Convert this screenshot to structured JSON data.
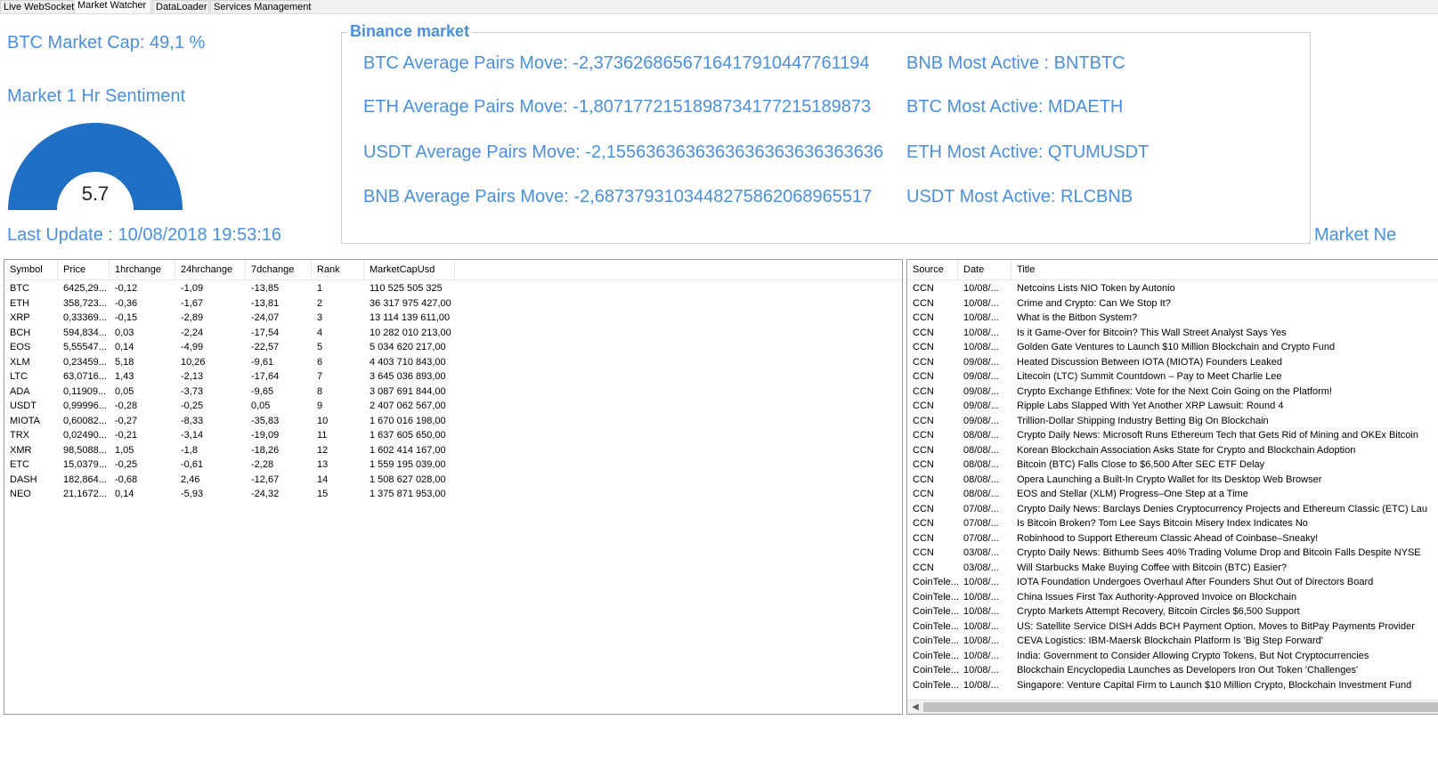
{
  "tabs": [
    {
      "label": "Live WebSocket",
      "active": false
    },
    {
      "label": "Market Watcher",
      "active": true
    },
    {
      "label": "DataLoader",
      "active": false
    },
    {
      "label": "Services Management",
      "active": false
    }
  ],
  "summary": {
    "market_cap_label": "BTC Market Cap: 49,1 %",
    "sentiment_label": "Market 1 Hr Sentiment",
    "gauge_value": "5.7",
    "last_update": "Last Update : 10/08/2018 19:53:16",
    "market_news_label": "Market Ne"
  },
  "colors": {
    "accent": "#4a8fe0",
    "gauge_fill": "#1f6fc5"
  },
  "binance": {
    "title": "Binance market",
    "rows": [
      {
        "move": "BTC Average Pairs Move: -2,3736268656716417910447761194",
        "active": "BNB Most Active : BNTBTC"
      },
      {
        "move": "ETH Average Pairs Move: -1,8071772151898734177215189873",
        "active": "BTC Most Active: MDAETH"
      },
      {
        "move": "USDT Average Pairs Move: -2,1556363636363636363636363636",
        "active": "ETH Most Active: QTUMUSDT"
      },
      {
        "move": "BNB Average Pairs Move: -2,6873793103448275862068965517",
        "active": "USDT Most Active: RLCBNB"
      }
    ]
  },
  "coins": {
    "columns": [
      "Symbol",
      "Price",
      "1hrchange",
      "24hrchange",
      "7dchange",
      "Rank",
      "MarketCapUsd"
    ],
    "rows": [
      [
        "BTC",
        "6425,29...",
        "-0,12",
        "-1,09",
        "-13,85",
        "1",
        "110 525 505 325"
      ],
      [
        "ETH",
        "358,723...",
        "-0,36",
        "-1,67",
        "-13,81",
        "2",
        "36 317 975 427,00"
      ],
      [
        "XRP",
        "0,33369...",
        "-0,15",
        "-2,89",
        "-24,07",
        "3",
        "13 114 139 611,00"
      ],
      [
        "BCH",
        "594,834...",
        "0,03",
        "-2,24",
        "-17,54",
        "4",
        "10 282 010 213,00"
      ],
      [
        "EOS",
        "5,55547...",
        "0,14",
        "-4,99",
        "-22,57",
        "5",
        "5 034 620 217,00"
      ],
      [
        "XLM",
        "0,23459...",
        "5,18",
        "10,26",
        "-9,61",
        "6",
        "4 403 710 843,00"
      ],
      [
        "LTC",
        "63,0716...",
        "1,43",
        "-2,13",
        "-17,64",
        "7",
        "3 645 036 893,00"
      ],
      [
        "ADA",
        "0,11909...",
        "0,05",
        "-3,73",
        "-9,65",
        "8",
        "3 087 691 844,00"
      ],
      [
        "USDT",
        "0,99996...",
        "-0,28",
        "-0,25",
        "0,05",
        "9",
        "2 407 062 567,00"
      ],
      [
        "MIOTA",
        "0,60082...",
        "-0,27",
        "-8,33",
        "-35,83",
        "10",
        "1 670 016 198,00"
      ],
      [
        "TRX",
        "0,02490...",
        "-0,21",
        "-3,14",
        "-19,09",
        "11",
        "1 637 605 650,00"
      ],
      [
        "XMR",
        "98,5088...",
        "1,05",
        "-1,8",
        "-18,26",
        "12",
        "1 602 414 167,00"
      ],
      [
        "ETC",
        "15,0379...",
        "-0,25",
        "-0,61",
        "-2,28",
        "13",
        "1 559 195 039,00"
      ],
      [
        "DASH",
        "182,864...",
        "-0,68",
        "2,46",
        "-12,67",
        "14",
        "1 508 627 028,00"
      ],
      [
        "NEO",
        "21,1672...",
        "0,14",
        "-5,93",
        "-24,32",
        "15",
        "1 375 871 953,00"
      ]
    ]
  },
  "news": {
    "columns": [
      "Source",
      "Date",
      "Title"
    ],
    "rows": [
      [
        "CCN",
        "10/08/...",
        "Netcoins Lists NIO Token by Autonio"
      ],
      [
        "CCN",
        "10/08/...",
        "Crime and Crypto: Can We Stop It?"
      ],
      [
        "CCN",
        "10/08/...",
        "What is the Bitbon System?"
      ],
      [
        "CCN",
        "10/08/...",
        "Is it Game-Over for Bitcoin? This Wall Street Analyst Says Yes"
      ],
      [
        "CCN",
        "10/08/...",
        "Golden Gate Ventures to Launch $10 Million Blockchain and Crypto Fund"
      ],
      [
        "CCN",
        "09/08/...",
        "Heated Discussion Between IOTA (MIOTA) Founders Leaked"
      ],
      [
        "CCN",
        "09/08/...",
        "Litecoin (LTC) Summit Countdown – Pay to Meet Charlie Lee"
      ],
      [
        "CCN",
        "09/08/...",
        "Crypto Exchange Ethfinex: Vote for the Next Coin Going on the Platform!"
      ],
      [
        "CCN",
        "09/08/...",
        "Ripple Labs Slapped With Yet Another XRP Lawsuit: Round 4"
      ],
      [
        "CCN",
        "09/08/...",
        "Trillion-Dollar Shipping Industry Betting Big On Blockchain"
      ],
      [
        "CCN",
        "08/08/...",
        "Crypto Daily News: Microsoft Runs Ethereum Tech that Gets Rid of Mining and OKEx Bitcoin"
      ],
      [
        "CCN",
        "08/08/...",
        "Korean Blockchain Association Asks State for Crypto and Blockchain Adoption"
      ],
      [
        "CCN",
        "08/08/...",
        "Bitcoin (BTC) Falls Close to $6,500 After SEC ETF Delay"
      ],
      [
        "CCN",
        "08/08/...",
        "Opera Launching a Built-In Crypto Wallet for Its Desktop Web Browser"
      ],
      [
        "CCN",
        "08/08/...",
        "EOS and Stellar (XLM) Progress–One Step at a Time"
      ],
      [
        "CCN",
        "07/08/...",
        "Crypto Daily News: Barclays Denies Cryptocurrency Projects and Ethereum Classic (ETC) Lau"
      ],
      [
        "CCN",
        "07/08/...",
        "Is Bitcoin Broken? Tom Lee Says Bitcoin Misery Index Indicates No"
      ],
      [
        "CCN",
        "07/08/...",
        "Robinhood to Support Ethereum Classic Ahead of Coinbase–Sneaky!"
      ],
      [
        "CCN",
        "03/08/...",
        "Crypto Daily News: Bithumb Sees 40% Trading Volume Drop and Bitcoin Falls Despite NYSE"
      ],
      [
        "CCN",
        "03/08/...",
        "Will Starbucks Make Buying Coffee with Bitcoin (BTC) Easier?"
      ],
      [
        "CoinTele...",
        "10/08/...",
        "IOTA Foundation Undergoes Overhaul After Founders Shut Out of Directors Board"
      ],
      [
        "CoinTele...",
        "10/08/...",
        "China Issues First Tax Authority-Approved Invoice on Blockchain"
      ],
      [
        "CoinTele...",
        "10/08/...",
        "Crypto Markets Attempt Recovery, Bitcoin Circles $6,500 Support"
      ],
      [
        "CoinTele...",
        "10/08/...",
        "US: Satellite Service DISH Adds BCH Payment Option, Moves to BitPay Payments Provider"
      ],
      [
        "CoinTele...",
        "10/08/...",
        "CEVA Logistics: IBM-Maersk Blockchain Platform Is 'Big Step Forward'"
      ],
      [
        "CoinTele...",
        "10/08/...",
        "India: Government to Consider Allowing Crypto Tokens, But Not Cryptocurrencies"
      ],
      [
        "CoinTele...",
        "10/08/...",
        "Blockchain Encyclopedia Launches as Developers Iron Out Token 'Challenges'"
      ],
      [
        "CoinTele...",
        "10/08/...",
        "Singapore: Venture Capital Firm to Launch $10 Million Crypto, Blockchain Investment Fund"
      ]
    ]
  }
}
